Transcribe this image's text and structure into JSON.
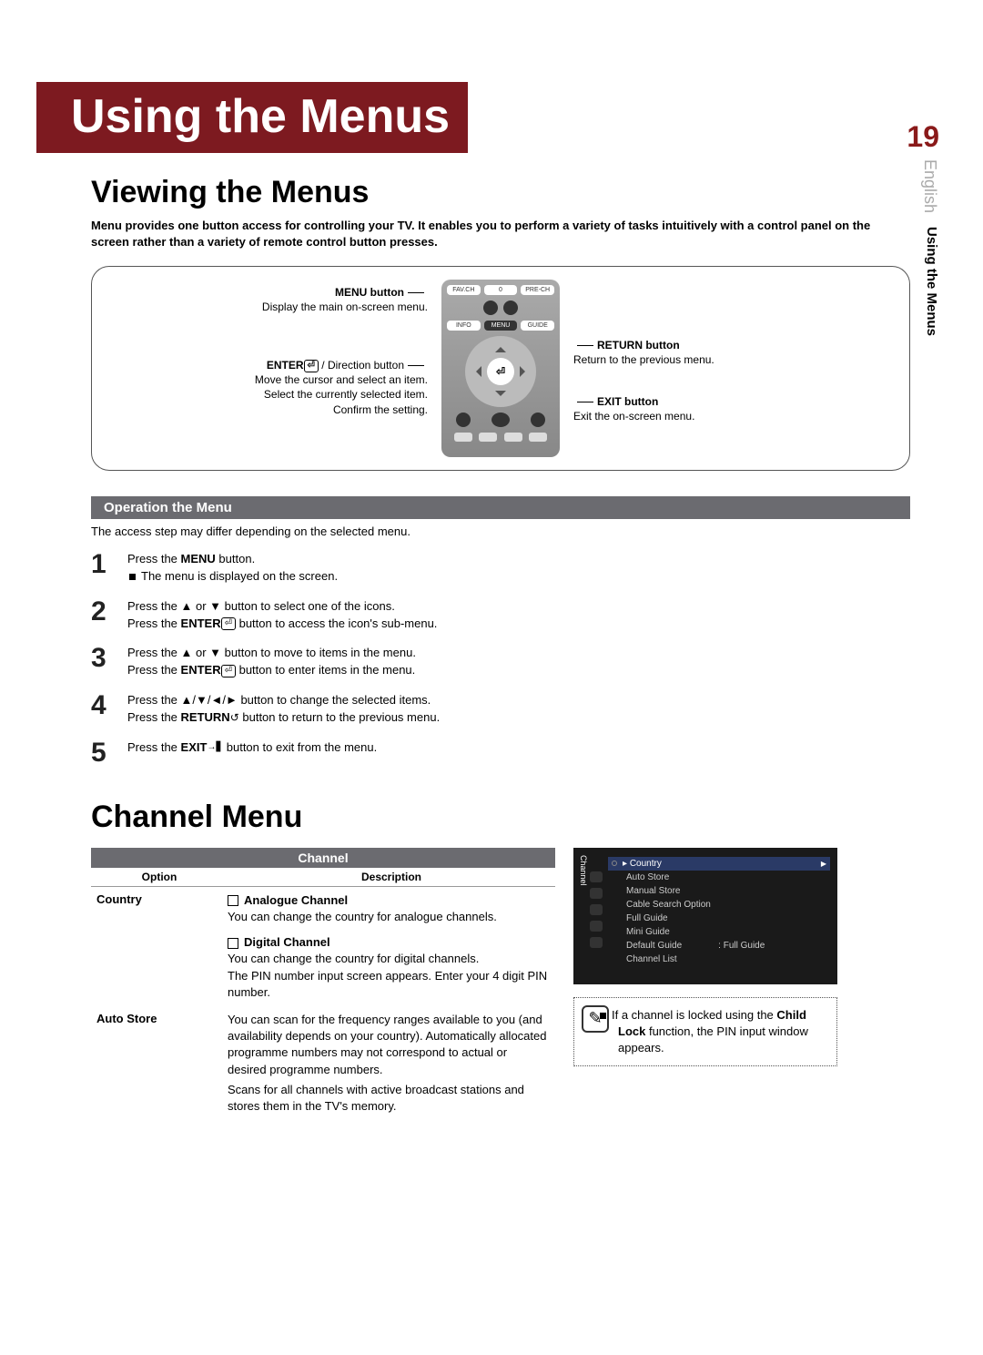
{
  "sidebar": {
    "page_num": "19",
    "language": "English",
    "section": "Using the Menus"
  },
  "chapter_title": "Using the Menus",
  "h_viewing": "Viewing the Menus",
  "intro": "Menu provides one button access for controlling your TV. It enables you to perform a variety of tasks intuitively with a control panel on the screen rather than a variety of remote control button presses.",
  "diagram": {
    "menu_btn_label": "MENU button",
    "menu_btn_desc": "Display the main on-screen menu.",
    "enter_btn_label": "ENTER",
    "enter_btn_suffix": " / Direction button",
    "enter_line1": "Move the cursor and select an item.",
    "enter_line2": "Select the currently selected item.",
    "enter_line3": "Confirm the setting.",
    "return_btn_label": "RETURN button",
    "return_btn_desc": "Return to the previous menu.",
    "exit_btn_label": "EXIT button",
    "exit_btn_desc": "Exit the on-screen menu.",
    "remote_buttons": {
      "favch": "FAV.CH",
      "zero": "0",
      "prech": "PRE-CH",
      "info": "INFO",
      "menu": "MENU",
      "guide": "GUIDE"
    }
  },
  "section_bar": "Operation the Menu",
  "access_note": "The access step may differ depending on the selected menu.",
  "steps": [
    {
      "num": "1",
      "l1": "Press the MENU button.",
      "bullet": "The menu is displayed on the screen."
    },
    {
      "num": "2",
      "l1": "Press the ▲ or ▼ button to select one of the icons.",
      "l2": "Press the ENTER⏎ button to access the icon's sub-menu."
    },
    {
      "num": "3",
      "l1": "Press the ▲ or ▼ button to move to items in the menu.",
      "l2": "Press the ENTER⏎ button to enter items in the menu."
    },
    {
      "num": "4",
      "l1": "Press the ▲/▼/◄/► button to change the selected items.",
      "l2": "Press the RETURN↺ button to return to the previous menu."
    },
    {
      "num": "5",
      "l1": "Press the EXIT→▋ button to exit from the menu."
    }
  ],
  "h_channel": "Channel Menu",
  "channel_table": {
    "title": "Channel",
    "col_option": "Option",
    "col_desc": "Description",
    "rows": {
      "country": {
        "label": "Country",
        "analogue_h": "Analogue Channel",
        "analogue_d": "You can change the country for analogue channels.",
        "digital_h": "Digital Channel",
        "digital_d1": "You can change the country for digital channels.",
        "digital_d2": "The PIN number input screen appears. Enter your 4 digit PIN number."
      },
      "auto_store": {
        "label": "Auto Store",
        "d1": "You can scan for the frequency ranges available to you (and availability depends on your country). Automatically allocated programme numbers may not correspond to actual or desired programme numbers.",
        "d2": "Scans for all channels with active broadcast stations and stores them in the TV's memory."
      }
    }
  },
  "osd": {
    "side": "Channel",
    "items": [
      "Country",
      "Auto Store",
      "Manual Store",
      "Cable Search Option",
      "Full Guide",
      "Mini Guide"
    ],
    "default_guide_label": "Default Guide",
    "default_guide_value": ": Full Guide",
    "channel_list": "Channel List"
  },
  "note": {
    "text_prefix": "If a channel is locked using the ",
    "child_lock": "Child Lock",
    "text_suffix": " function, the PIN input window appears."
  }
}
